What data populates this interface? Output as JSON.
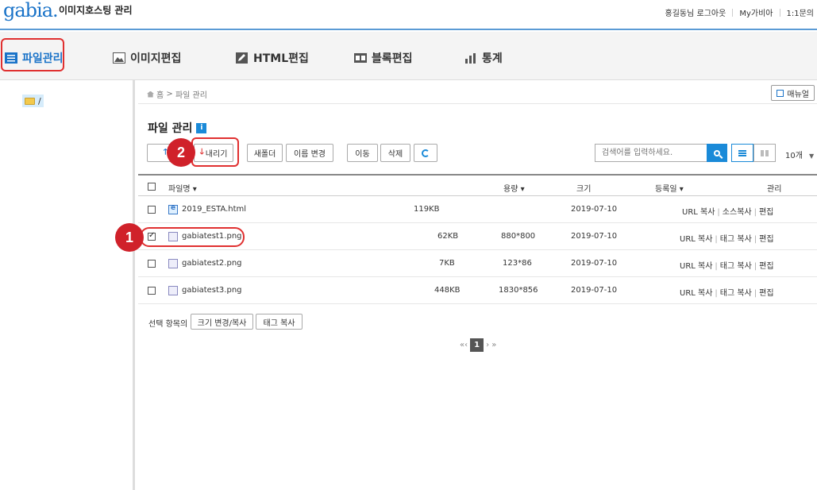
{
  "header": {
    "logo": "gabia.",
    "title": "이미지호스팅 관리",
    "user_greeting": "홍길동님",
    "logout": "로그아웃",
    "my_gabia": "My가비아",
    "one_on_one": "1:1문의"
  },
  "nav": {
    "tabs": [
      {
        "label": "파일관리",
        "icon": "file-list-icon",
        "active": true
      },
      {
        "label": "이미지편집",
        "icon": "image-icon"
      },
      {
        "label": "HTML편집",
        "icon": "pencil-icon"
      },
      {
        "label": "블록편집",
        "icon": "block-icon"
      },
      {
        "label": "통계",
        "icon": "bar-chart-icon"
      }
    ]
  },
  "tree": {
    "root_label": "/"
  },
  "breadcrumb": {
    "home": "홈",
    "sep": ">",
    "current": "파일 관리"
  },
  "manual_button": "매뉴얼",
  "page_title": "파일 관리",
  "info_badge": "i",
  "toolbar": {
    "upload": "올",
    "download": "내리기",
    "new_folder": "새폴더",
    "rename": "이름 변경",
    "move": "이동",
    "delete": "삭제"
  },
  "search": {
    "placeholder": "검색어를 입력하세요."
  },
  "per_page": "10개",
  "table": {
    "columns": {
      "name": "파일명 ▾",
      "size": "용량 ▾",
      "dimensions": "크기",
      "date": "등록일 ▾",
      "manage": "관리"
    },
    "rows": [
      {
        "name": "2019_ESTA.html",
        "size": "119KB",
        "dimensions": "",
        "date": "2019-07-10",
        "a1": "URL 복사",
        "a2": "소스복사",
        "a3": "편집",
        "type": "html",
        "checked": false
      },
      {
        "name": "gabiatest1.png",
        "size": "62KB",
        "dimensions": "880*800",
        "date": "2019-07-10",
        "a1": "URL 복사",
        "a2": "태그 복사",
        "a3": "편집",
        "type": "png",
        "checked": true
      },
      {
        "name": "gabiatest2.png",
        "size": "7KB",
        "dimensions": "123*86",
        "date": "2019-07-10",
        "a1": "URL 복사",
        "a2": "태그 복사",
        "a3": "편집",
        "type": "png",
        "checked": false
      },
      {
        "name": "gabiatest3.png",
        "size": "448KB",
        "dimensions": "1830*856",
        "date": "2019-07-10",
        "a1": "URL 복사",
        "a2": "태그 복사",
        "a3": "편집",
        "type": "png",
        "checked": false
      }
    ]
  },
  "selection": {
    "label": "선택 항목의",
    "resize_copy": "크기 변경/복사",
    "tag_copy": "태그 복사"
  },
  "pagination": {
    "prev": "«‹",
    "current": "1",
    "next": "› »"
  },
  "callouts": {
    "one": "1",
    "two": "2"
  },
  "colors": {
    "accent": "#1a73c8",
    "callout": "#d0212a"
  }
}
